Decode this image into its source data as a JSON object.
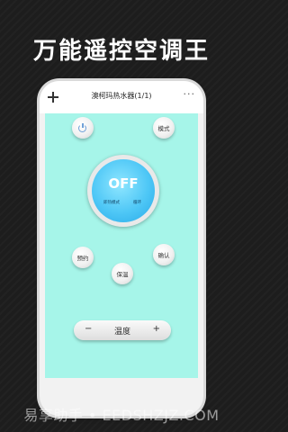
{
  "headline": "万能遥控空调王",
  "app": {
    "title": "澳柯玛热水器(1/1)",
    "add_icon": "plus-icon",
    "more_icon": "more-icon",
    "more_glyph": "···"
  },
  "remote": {
    "power_icon": "power-icon",
    "mode_label": "模式",
    "display": {
      "state": "OFF",
      "mode_text": "即热模式",
      "cycle_text": "循环"
    },
    "schedule_label": "预约",
    "confirm_label": "确认",
    "keep_warm_label": "保温",
    "temperature": {
      "label": "温度",
      "minus": "−",
      "plus": "+"
    }
  },
  "watermark": "易享助手 • EEDSHZJZ.COM",
  "colors": {
    "remote_bg": "#a6f5e9",
    "dial": "#4ec7f6",
    "background": "#1d1d1d"
  }
}
